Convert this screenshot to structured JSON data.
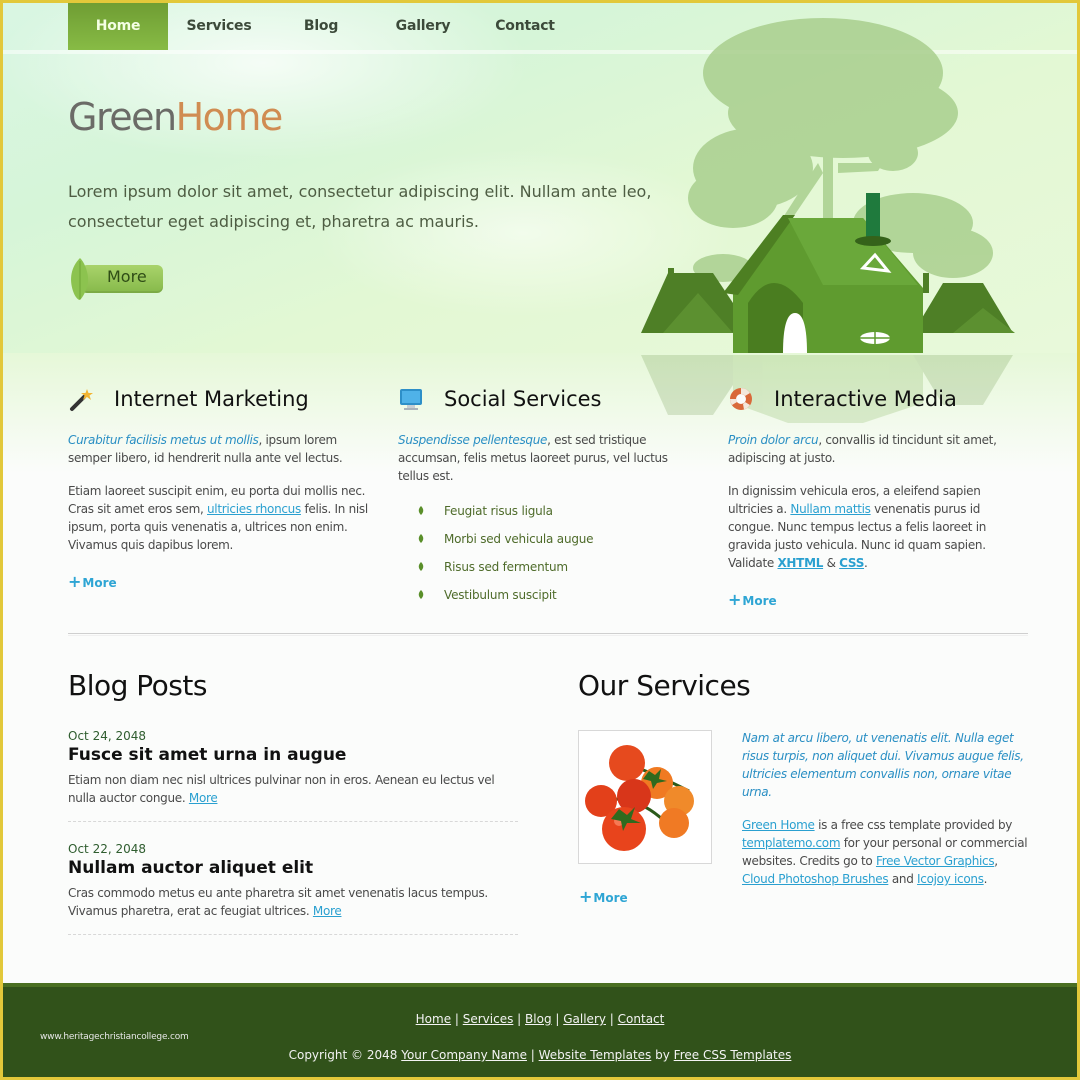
{
  "nav": {
    "items": [
      {
        "label": "Home",
        "active": true
      },
      {
        "label": "Services",
        "active": false
      },
      {
        "label": "Blog",
        "active": false
      },
      {
        "label": "Gallery",
        "active": false
      },
      {
        "label": "Contact",
        "active": false
      }
    ]
  },
  "hero": {
    "logo_part1": "Green",
    "logo_part2": "Home",
    "tagline": "Lorem ipsum dolor sit amet, consectetur adipiscing elit. Nullam ante leo, consectetur eget adipiscing et, pharetra ac mauris.",
    "more_label": "More",
    "illustration": "green-house-with-trees-icon"
  },
  "features": [
    {
      "icon": "magic-wand-icon",
      "title": "Internet Marketing",
      "lead": "Curabitur facilisis metus ut mollis",
      "lead_rest": ", ipsum lorem semper libero, id hendrerit nulla ante vel lectus.",
      "p2_before": "Etiam laoreet suscipit enim, eu porta dui mollis nec. Cras sit amet eros sem, ",
      "p2_link": "ultricies rhoncus",
      "p2_after": " felis. In nisl ipsum, porta quis venenatis a, ultrices non enim. Vivamus quis dapibus lorem.",
      "more_label": "More"
    },
    {
      "icon": "monitor-icon",
      "title": "Social Services",
      "lead": "Suspendisse pellentesque",
      "lead_rest": ", est sed tristique accumsan, felis metus laoreet purus, vel luctus tellus est.",
      "bullets": [
        "Feugiat risus ligula",
        "Morbi sed vehicula augue",
        "Risus sed fermentum",
        "Vestibulum suscipit"
      ]
    },
    {
      "icon": "lifebuoy-icon",
      "title": "Interactive Media",
      "lead": "Proin dolor arcu",
      "lead_rest": ", convallis id tincidunt sit amet, adipiscing at justo.",
      "p2_before": "In dignissim vehicula eros, a eleifend sapien ultricies a. ",
      "p2_link": "Nullam mattis",
      "p2_after": " venenatis purus id congue. Nunc tempus lectus a felis laoreet in gravida justo vehicula. Nunc id quam sapien. Validate ",
      "xhtml": "XHTML",
      "amp": " & ",
      "css": "CSS",
      "end": ".",
      "more_label": "More"
    }
  ],
  "blog": {
    "heading": "Blog Posts",
    "posts": [
      {
        "date": "Oct 24, 2048",
        "title": "Fusce sit amet urna in augue",
        "body": "Etiam non diam nec nisl ultrices pulvinar non in eros. Aenean eu lectus vel nulla auctor congue. ",
        "more": "More"
      },
      {
        "date": "Oct 22, 2048",
        "title": "Nullam auctor aliquet elit",
        "body": "Cras commodo metus eu ante pharetra sit amet venenatis lacus tempus. Vivamus pharetra, erat ac feugiat ultrices. ",
        "more": "More"
      }
    ]
  },
  "services": {
    "heading": "Our Services",
    "image": "tomatoes-photo",
    "intro": "Nam at arcu libero, ut venenatis elit. Nulla eget risus turpis, non aliquet dui. Vivamus augue felis, ultricies elementum convallis non, ornare vitae urna.",
    "link1": "Green Home",
    "t1": " is a free css template provided by ",
    "link2": "templatemo.com",
    "t2": " for your personal or commercial websites. Credits go to ",
    "link3": "Free Vector Graphics",
    "t3": ", ",
    "link4": "Cloud Photoshop Brushes",
    "t4": " and ",
    "link5": "Icojoy icons",
    "t5": ".",
    "more_label": "More"
  },
  "footer": {
    "nav": [
      "Home",
      "Services",
      "Blog",
      "Gallery",
      "Contact"
    ],
    "sep": " | ",
    "copyright_prefix": "Copyright © 2048 ",
    "company": "Your Company Name",
    "website_templates": "Website Templates",
    "by": " by ",
    "free_css": "Free CSS Templates",
    "watermark": "www.heritagechristiancollege.com"
  },
  "colors": {
    "accent_green": "#7aab3c",
    "footer_green": "#31521a",
    "link_blue": "#2aa0d0",
    "logo_orange": "#d08c52",
    "border_yellow": "#e2c83a"
  }
}
